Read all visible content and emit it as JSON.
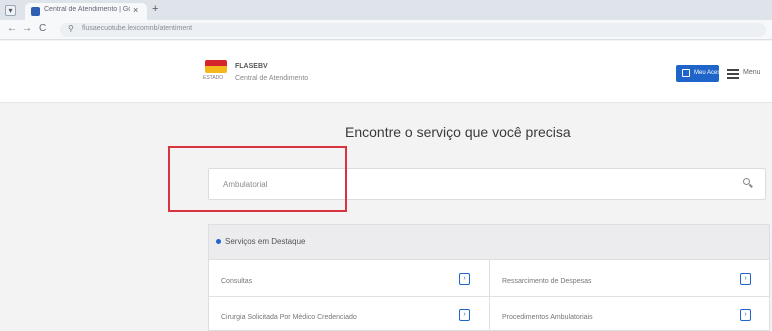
{
  "browser": {
    "tab_title": "Central de Atendimento | Gov",
    "tab_close": "×",
    "new_tab": "+",
    "url": "flusaecuotube.lexcomnb/atentiment",
    "back": "←",
    "forward": "→",
    "reload": "C"
  },
  "header": {
    "brand_name": "FLASEBV",
    "brand_sub": "Central de Atendimento",
    "flag_caption": "ESTADO",
    "login_label": "Meu Acesso",
    "menu_label": "Menu"
  },
  "main": {
    "heading": "Encontre o serviço que você precisa",
    "search_value": "Ambulatorial"
  },
  "featured": {
    "title": "Serviços em Destaque",
    "services": [
      {
        "label": "Consultas",
        "arrow": "›"
      },
      {
        "label": "Ressarcimento de Despesas",
        "arrow": "›"
      },
      {
        "label": "Cirurgia Solicitada Por Médico Credenciado",
        "arrow": "›"
      },
      {
        "label": "Procedimentos Ambulatoriais",
        "arrow": "›"
      }
    ]
  },
  "colors": {
    "accent": "#1f65c9",
    "highlight": "#d8343f",
    "flag_red": "#d4232a",
    "flag_yellow": "#f3b81b"
  }
}
